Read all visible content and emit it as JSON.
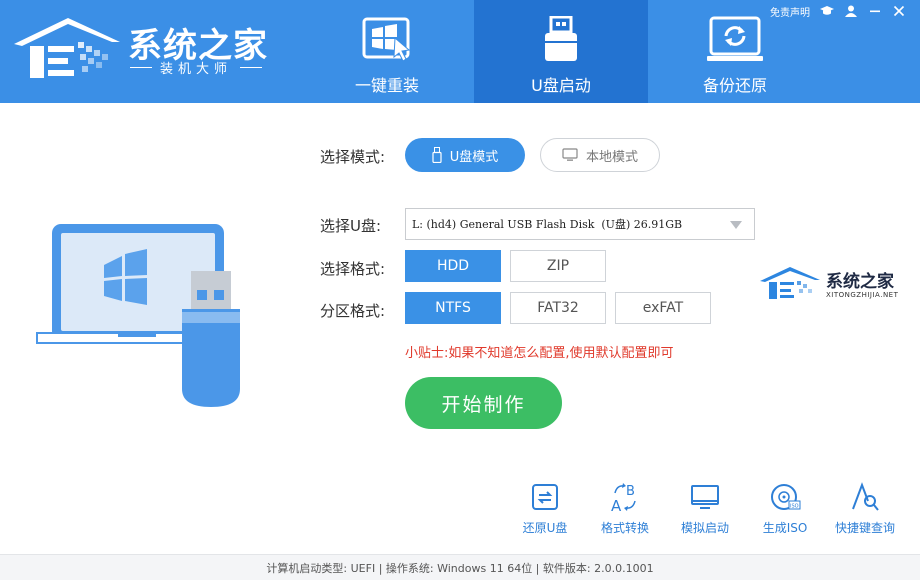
{
  "colors": {
    "header": "#3b8fe6",
    "active_tab": "#2373d1",
    "accent": "#3a91e6",
    "start": "#3cbe64",
    "tip": "#e0392b",
    "tool": "#2e7fd6"
  },
  "logo": {
    "title": "系统之家",
    "subtitle": "装机大师"
  },
  "tabs": [
    {
      "label": "一键重装",
      "icon": "windows-install-icon",
      "active": false
    },
    {
      "label": "U盘启动",
      "icon": "usb-drive-icon",
      "active": true
    },
    {
      "label": "备份还原",
      "icon": "backup-restore-icon",
      "active": false
    }
  ],
  "toplinks": {
    "disclaimer": "免责声明",
    "icons": [
      "graduation-cap-icon",
      "user-icon",
      "minimize-icon",
      "close-icon"
    ]
  },
  "form": {
    "mode_label": "选择模式:",
    "mode_options": [
      {
        "label": "U盘模式",
        "icon": "usb-stick-icon",
        "selected": true
      },
      {
        "label": "本地模式",
        "icon": "monitor-icon",
        "selected": false
      }
    ],
    "disk_label": "选择U盘:",
    "disk_value": "L: (hd4) General USB Flash Disk  (U盘) 26.91GB",
    "format_label": "选择格式:",
    "format_options": [
      {
        "label": "HDD",
        "selected": true
      },
      {
        "label": "ZIP",
        "selected": false
      }
    ],
    "partition_label": "分区格式:",
    "partition_options": [
      {
        "label": "NTFS",
        "selected": true
      },
      {
        "label": "FAT32",
        "selected": false
      },
      {
        "label": "exFAT",
        "selected": false
      }
    ],
    "tip": "小贴士:如果不知道怎么配置,使用默认配置即可",
    "start_label": "开始制作"
  },
  "watermark": {
    "title": "系统之家",
    "sub": "XITONGZHIJIA.NET"
  },
  "tools": [
    {
      "label": "还原U盘",
      "icon": "restore-usb-icon"
    },
    {
      "label": "格式转换",
      "icon": "format-convert-icon"
    },
    {
      "label": "模拟启动",
      "icon": "simulate-boot-icon"
    },
    {
      "label": "生成ISO",
      "icon": "iso-disc-icon"
    },
    {
      "label": "快捷键查询",
      "icon": "hotkey-search-icon"
    }
  ],
  "status": "计算机启动类型: UEFI | 操作系统: Windows 11 64位 | 软件版本: 2.0.0.1001"
}
